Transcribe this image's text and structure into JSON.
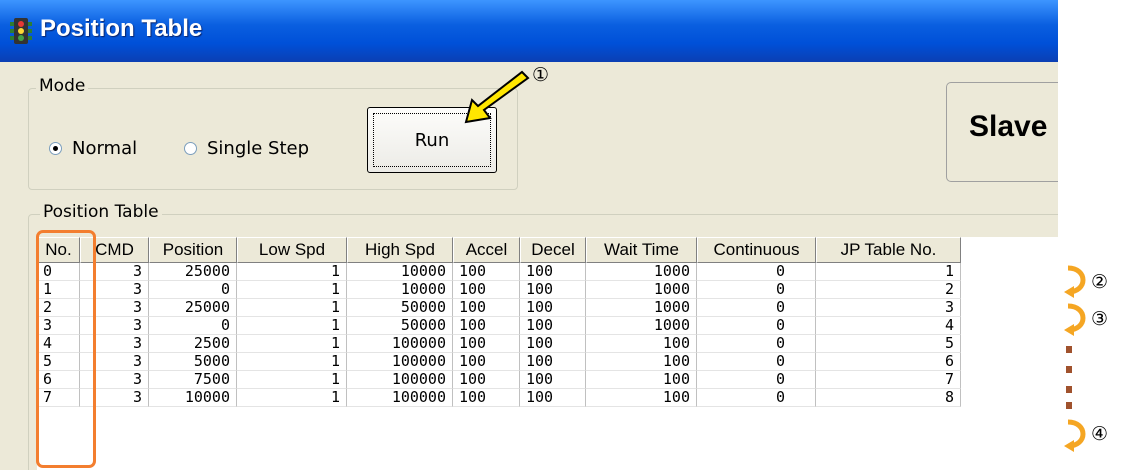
{
  "window": {
    "title": "Position Table"
  },
  "mode": {
    "label": "Mode",
    "options": [
      {
        "label": "Normal",
        "selected": true
      },
      {
        "label": "Single Step",
        "selected": false
      }
    ],
    "run_label": "Run"
  },
  "slave": {
    "label": "Slave"
  },
  "table": {
    "label": "Position Table",
    "columns": [
      "No.",
      "CMD",
      "Position",
      "Low Spd",
      "High Spd",
      "Accel",
      "Decel",
      "Wait Time",
      "Continuous",
      "JP Table No."
    ],
    "rows": [
      [
        "0",
        "3",
        "25000",
        "1",
        "10000",
        "100",
        "100",
        "1000",
        "0",
        "1"
      ],
      [
        "1",
        "3",
        "0",
        "1",
        "10000",
        "100",
        "100",
        "1000",
        "0",
        "2"
      ],
      [
        "2",
        "3",
        "25000",
        "1",
        "50000",
        "100",
        "100",
        "1000",
        "0",
        "3"
      ],
      [
        "3",
        "3",
        "0",
        "1",
        "50000",
        "100",
        "100",
        "1000",
        "0",
        "4"
      ],
      [
        "4",
        "3",
        "2500",
        "1",
        "100000",
        "100",
        "100",
        "100",
        "0",
        "5"
      ],
      [
        "5",
        "3",
        "5000",
        "1",
        "100000",
        "100",
        "100",
        "100",
        "0",
        "6"
      ],
      [
        "6",
        "3",
        "7500",
        "1",
        "100000",
        "100",
        "100",
        "100",
        "0",
        "7"
      ],
      [
        "7",
        "3",
        "10000",
        "1",
        "100000",
        "100",
        "100",
        "100",
        "0",
        "8"
      ]
    ]
  },
  "annotations": {
    "step1": "①",
    "step2": "②",
    "step3": "③",
    "step4": "④"
  },
  "colors": {
    "titlebar": "#0a5fe0",
    "highlight": "#f37e2f",
    "arrow": "#ffe600",
    "loop_arrow": "#f5a623",
    "ellipsis": "#a0522d"
  }
}
